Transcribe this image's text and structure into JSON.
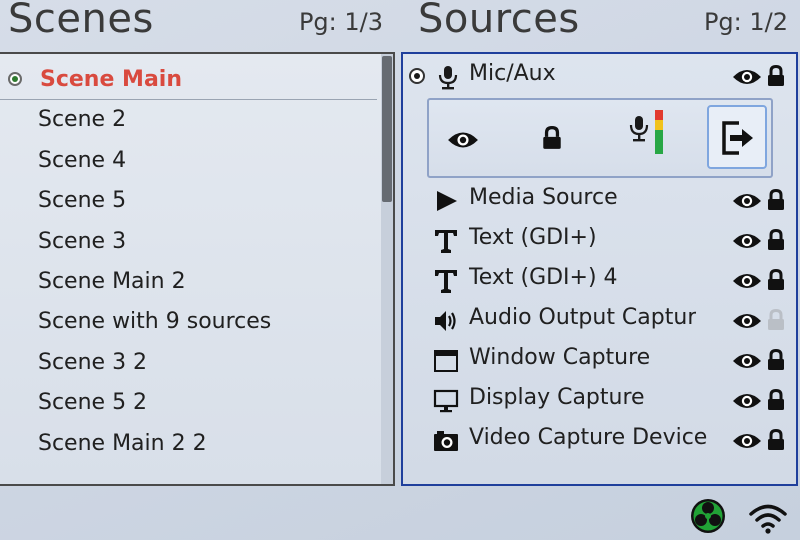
{
  "scenes": {
    "title": "Scenes",
    "page": "Pg: 1/3",
    "items": [
      {
        "label": "Scene Main",
        "active": true
      },
      {
        "label": "Scene  2"
      },
      {
        "label": "Scene 4"
      },
      {
        "label": "Scene 5"
      },
      {
        "label": "Scene 3"
      },
      {
        "label": "Scene Main 2"
      },
      {
        "label": "Scene with 9 sources"
      },
      {
        "label": "Scene 3 2"
      },
      {
        "label": "Scene 5 2"
      },
      {
        "label": "Scene Main 2 2"
      }
    ]
  },
  "sources": {
    "title": "Sources",
    "page": "Pg: 1/2",
    "selected": {
      "label": "Mic/Aux",
      "icon": "microphone-icon"
    },
    "controls": [
      {
        "name": "visibility",
        "icon": "eye-icon"
      },
      {
        "name": "lock",
        "icon": "lock-icon"
      },
      {
        "name": "audio-level",
        "icon": "microphone-level-icon"
      },
      {
        "name": "exit",
        "icon": "exit-icon"
      }
    ],
    "items": [
      {
        "label": "Media Source",
        "icon": "play-icon"
      },
      {
        "label": "Text (GDI+)",
        "icon": "text-icon"
      },
      {
        "label": "Text (GDI+) 4",
        "icon": "text-icon"
      },
      {
        "label": "Audio Output Captur",
        "icon": "speaker-icon",
        "locked": false
      },
      {
        "label": "Window Capture",
        "icon": "window-icon"
      },
      {
        "label": "Display Capture",
        "icon": "monitor-icon"
      },
      {
        "label": "Video Capture Device",
        "icon": "camera-icon"
      }
    ]
  },
  "status": {
    "logo": "obs-logo-icon",
    "wifi": "wifi-icon"
  },
  "colors": {
    "active_scene": "#d94a3f",
    "sources_border": "#1f3f9c",
    "logo_green": "#21a336"
  }
}
